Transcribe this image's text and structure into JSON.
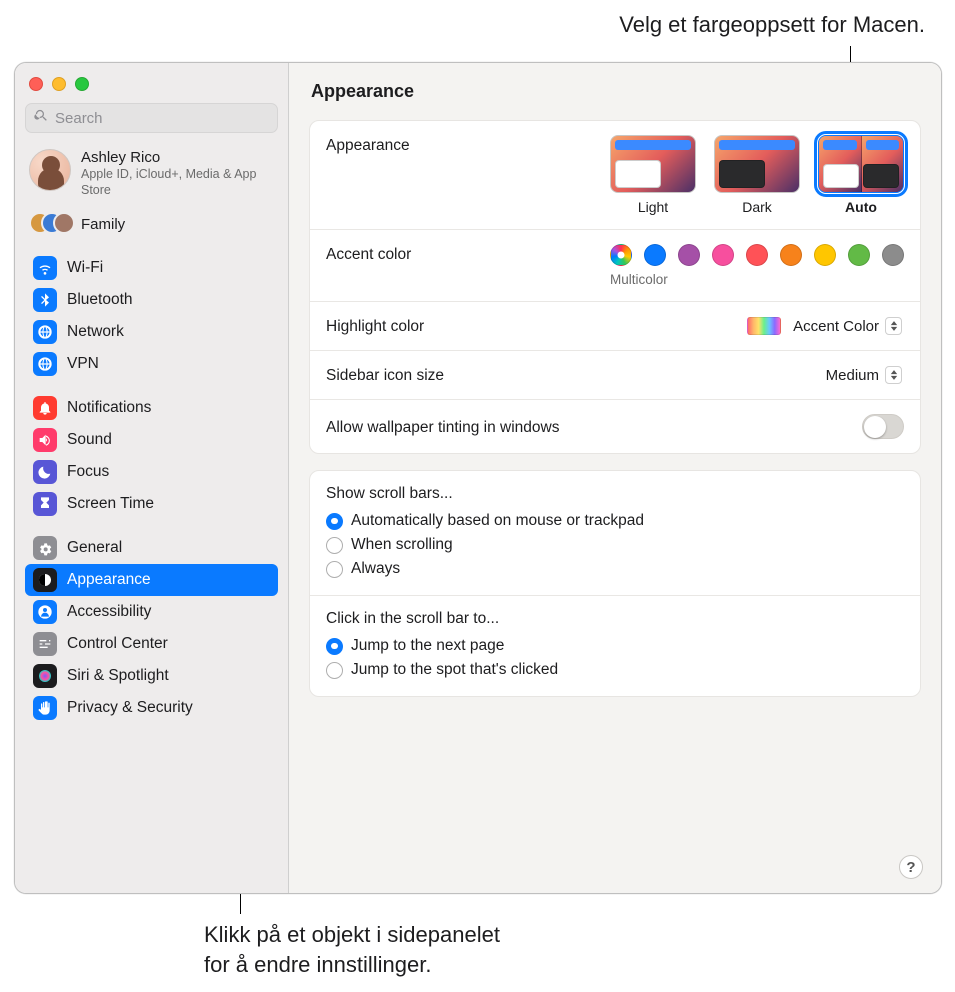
{
  "callouts": {
    "top": "Velg et fargeoppsett for Macen.",
    "bottom": "Klikk på et objekt i sidepanelet\nfor å endre innstillinger."
  },
  "search": {
    "placeholder": "Search"
  },
  "account": {
    "name": "Ashley Rico",
    "subtitle": "Apple ID, iCloud+, Media & App Store"
  },
  "family": {
    "label": "Family"
  },
  "sidebar": {
    "group1": [
      {
        "label": "Wi-Fi",
        "name": "wifi",
        "bg": "#0a7aff",
        "glyph": "wifi"
      },
      {
        "label": "Bluetooth",
        "name": "bluetooth",
        "bg": "#0a7aff",
        "glyph": "bluetooth"
      },
      {
        "label": "Network",
        "name": "network",
        "bg": "#0a7aff",
        "glyph": "globe"
      },
      {
        "label": "VPN",
        "name": "vpn",
        "bg": "#0a7aff",
        "glyph": "globe"
      }
    ],
    "group2": [
      {
        "label": "Notifications",
        "name": "notifications",
        "bg": "#ff3b30",
        "glyph": "bell"
      },
      {
        "label": "Sound",
        "name": "sound",
        "bg": "#ff3b6b",
        "glyph": "speaker"
      },
      {
        "label": "Focus",
        "name": "focus",
        "bg": "#5856d6",
        "glyph": "moon"
      },
      {
        "label": "Screen Time",
        "name": "screentime",
        "bg": "#5856d6",
        "glyph": "hourglass"
      }
    ],
    "group3": [
      {
        "label": "General",
        "name": "general",
        "bg": "#8e8e93",
        "glyph": "gear"
      },
      {
        "label": "Appearance",
        "name": "appearance",
        "bg": "#1c1c1e",
        "glyph": "appearance",
        "active": true
      },
      {
        "label": "Accessibility",
        "name": "accessibility",
        "bg": "#0a7aff",
        "glyph": "person"
      },
      {
        "label": "Control Center",
        "name": "controlcenter",
        "bg": "#8e8e93",
        "glyph": "sliders"
      },
      {
        "label": "Siri & Spotlight",
        "name": "siri",
        "bg": "#1c1c1e",
        "glyph": "siri"
      },
      {
        "label": "Privacy & Security",
        "name": "privacy",
        "bg": "#0a7aff",
        "glyph": "hand"
      }
    ]
  },
  "main": {
    "title": "Appearance",
    "appearance": {
      "label": "Appearance",
      "options": [
        {
          "label": "Light",
          "selected": false
        },
        {
          "label": "Dark",
          "selected": false
        },
        {
          "label": "Auto",
          "selected": true
        }
      ]
    },
    "accent": {
      "label": "Accent color",
      "sublabel": "Multicolor",
      "colors": [
        {
          "name": "multicolor",
          "hex": "multi",
          "selected": true
        },
        {
          "name": "blue",
          "hex": "#0a7aff"
        },
        {
          "name": "purple",
          "hex": "#a550a7"
        },
        {
          "name": "pink",
          "hex": "#f74f9e"
        },
        {
          "name": "red",
          "hex": "#ff5257"
        },
        {
          "name": "orange",
          "hex": "#f7821b"
        },
        {
          "name": "yellow",
          "hex": "#ffc600"
        },
        {
          "name": "green",
          "hex": "#62ba46"
        },
        {
          "name": "graphite",
          "hex": "#8c8c8c"
        }
      ]
    },
    "highlight": {
      "label": "Highlight color",
      "value": "Accent Color"
    },
    "sidebar_size": {
      "label": "Sidebar icon size",
      "value": "Medium"
    },
    "tinting": {
      "label": "Allow wallpaper tinting in windows",
      "on": false
    },
    "scrollbars": {
      "title": "Show scroll bars...",
      "options": [
        {
          "label": "Automatically based on mouse or trackpad",
          "checked": true
        },
        {
          "label": "When scrolling",
          "checked": false
        },
        {
          "label": "Always",
          "checked": false
        }
      ]
    },
    "scrollclick": {
      "title": "Click in the scroll bar to...",
      "options": [
        {
          "label": "Jump to the next page",
          "checked": true
        },
        {
          "label": "Jump to the spot that's clicked",
          "checked": false
        }
      ]
    },
    "help": "?"
  }
}
